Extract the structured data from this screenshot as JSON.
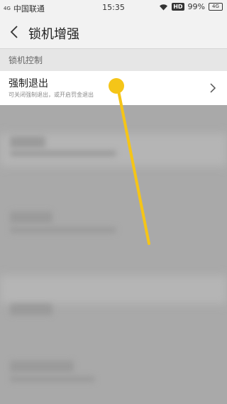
{
  "status_bar": {
    "carrier": "中国联通",
    "time": "15:35",
    "hd_label": "HD",
    "battery_percent": "99%",
    "battery_label": "4G",
    "signal_label": "4G"
  },
  "header": {
    "title": "锁机增强"
  },
  "section": {
    "title": "锁机控制"
  },
  "setting": {
    "title": "强制退出",
    "description": "可关闭强制退出，或开启罚金退出"
  },
  "gesture": {
    "color": "#F5C518"
  }
}
